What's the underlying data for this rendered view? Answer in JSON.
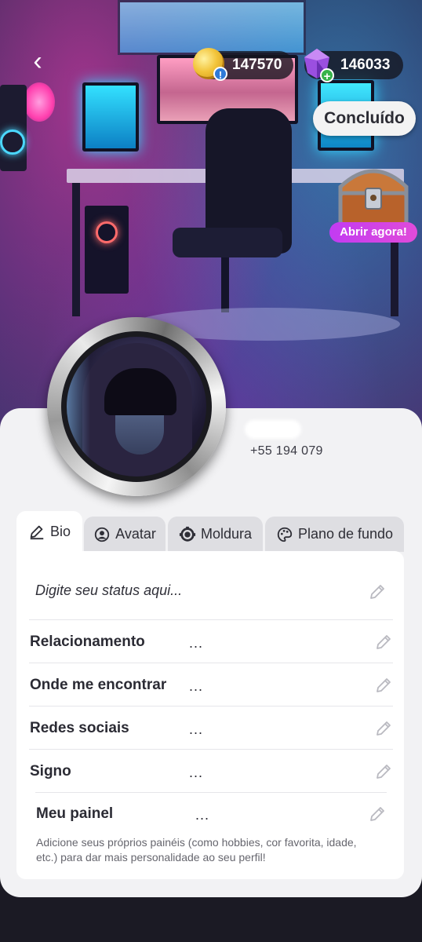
{
  "header": {
    "back_label": "‹",
    "coins": "147570",
    "gems": "146033",
    "done_label": "Concluído",
    "chest_label": "Abrir agora!"
  },
  "profile": {
    "phone": "+55 194 079"
  },
  "tabs": [
    {
      "label": "Bio",
      "icon": "edit-icon",
      "active": true
    },
    {
      "label": "Avatar",
      "icon": "avatar-icon",
      "active": false
    },
    {
      "label": "Moldura",
      "icon": "frame-icon",
      "active": false
    },
    {
      "label": "Plano de fundo",
      "icon": "palette-icon",
      "active": false
    }
  ],
  "bio": {
    "status_placeholder": "Digite seu status aqui...",
    "fields": [
      {
        "label": "Relacionamento",
        "value": "..."
      },
      {
        "label": "Onde me encontrar",
        "value": "..."
      },
      {
        "label": "Redes sociais",
        "value": "..."
      },
      {
        "label": "Signo",
        "value": "..."
      }
    ],
    "painel": {
      "label": "Meu painel",
      "value": "...",
      "help": "Adicione seus próprios painéis (como hobbies, cor favorita, idade, etc.) para dar mais personalidade ao seu perfil!"
    }
  },
  "colors": {
    "card_bg": "#f2f2f4",
    "chest_button": "#d042e6",
    "gem_badge": "#37b34a",
    "coin_badge": "#2f7ad8"
  }
}
